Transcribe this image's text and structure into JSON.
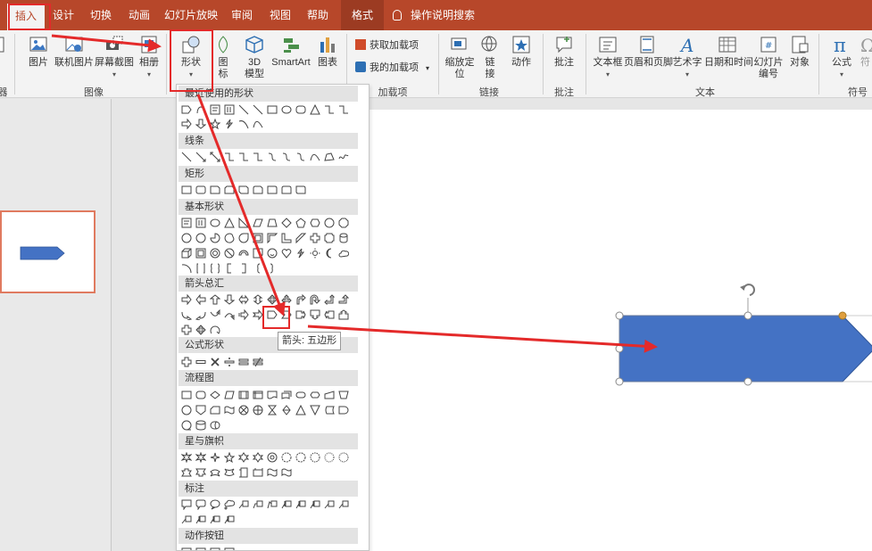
{
  "tabs": [
    {
      "label": "插入",
      "active": true
    },
    {
      "label": "设计"
    },
    {
      "label": "切换"
    },
    {
      "label": "动画"
    },
    {
      "label": "幻灯片放映"
    },
    {
      "label": "审阅"
    },
    {
      "label": "视图"
    },
    {
      "label": "帮助"
    },
    {
      "label": "格式"
    }
  ],
  "search": {
    "label": "操作说明搜索"
  },
  "ribbon": {
    "image_group": {
      "label": "图像",
      "picture": "图片",
      "online_picture": "联机图片",
      "screenshot": "屏幕截图",
      "album": "相册"
    },
    "shape_group": {
      "shapes": "形状",
      "icons": "图标",
      "3d_model": "3D模型",
      "3d_line1": "3D",
      "3d_line2": "模型",
      "icons_line1": "图",
      "icons_line2": "标",
      "smartart": "SmartArt",
      "chart": "图表"
    },
    "addin_group": {
      "label": "加载项",
      "get_addins": "获取加载项",
      "my_addins": "我的加载项"
    },
    "link_group": {
      "label": "链接",
      "zoom": "缩放定位",
      "zoom_line1": "缩放定",
      "zoom_line2": "位",
      "link_line1": "链",
      "link_line2": "接",
      "action": "动作"
    },
    "comment_group": {
      "label": "批注",
      "comment": "批注"
    },
    "text_group": {
      "label": "文本",
      "textbox": "文本框",
      "header_footer": "页眉和页脚",
      "wordart": "艺术字",
      "datetime": "日期和时间",
      "slide_num_line1": "幻灯片",
      "slide_num_line2": "编号",
      "object": "对象"
    },
    "symbol_group": {
      "label": "符号",
      "equation": "公式",
      "symbol_partial": "符"
    },
    "left_partial_group": "器"
  },
  "dropdown": {
    "categories": {
      "recent": "最近使用的形状",
      "lines": "线条",
      "rect": "矩形",
      "basic": "基本形状",
      "arrows": "箭头总汇",
      "equation": "公式形状",
      "flowchart": "流程图",
      "stars": "星与旗帜",
      "callouts": "标注",
      "action": "动作按钮"
    },
    "tooltip": "箭头: 五边形"
  },
  "colors": {
    "accent": "#b7472a",
    "shape_fill": "#4472c4",
    "shape_stroke": "#2f5597",
    "highlight": "#e42a2a",
    "handle_yellow": "#e0a040"
  }
}
